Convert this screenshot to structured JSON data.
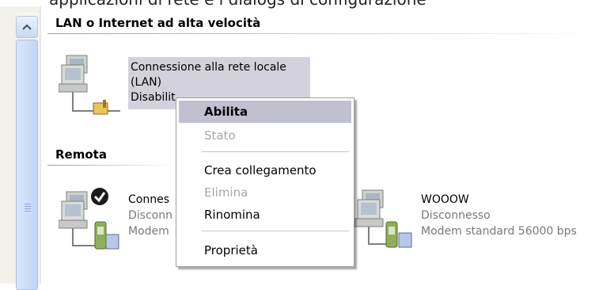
{
  "top_text": "applicazioni di rete e i dialogs di configurazione",
  "groups": {
    "lan": "LAN o Internet ad alta velocità",
    "remote": "Remota"
  },
  "connections": {
    "lan": {
      "name_line1": "Connessione alla rete locale",
      "name_line2": "(LAN)",
      "status": "Disabilit"
    },
    "remote1": {
      "name": "Connes",
      "status": "Disconn",
      "device": "Modem"
    },
    "remote2": {
      "name": "WOOOW",
      "status": "Disconnesso",
      "device": "Modem standard 56000 bps"
    }
  },
  "context_menu": {
    "items": [
      {
        "label": "Abilita",
        "state": "default"
      },
      {
        "label": "Stato",
        "state": "disabled"
      },
      {
        "label": "Crea collegamento",
        "state": "enabled"
      },
      {
        "label": "Elimina",
        "state": "disabled"
      },
      {
        "label": "Rinomina",
        "state": "enabled"
      },
      {
        "label": "Proprietà",
        "state": "enabled"
      }
    ]
  },
  "colors": {
    "selection_bg": "#d3d2dc",
    "menu_highlight": "#c0c0d0",
    "disabled_text": "#a8a8a8",
    "group_rule": "#7fa0d6"
  }
}
